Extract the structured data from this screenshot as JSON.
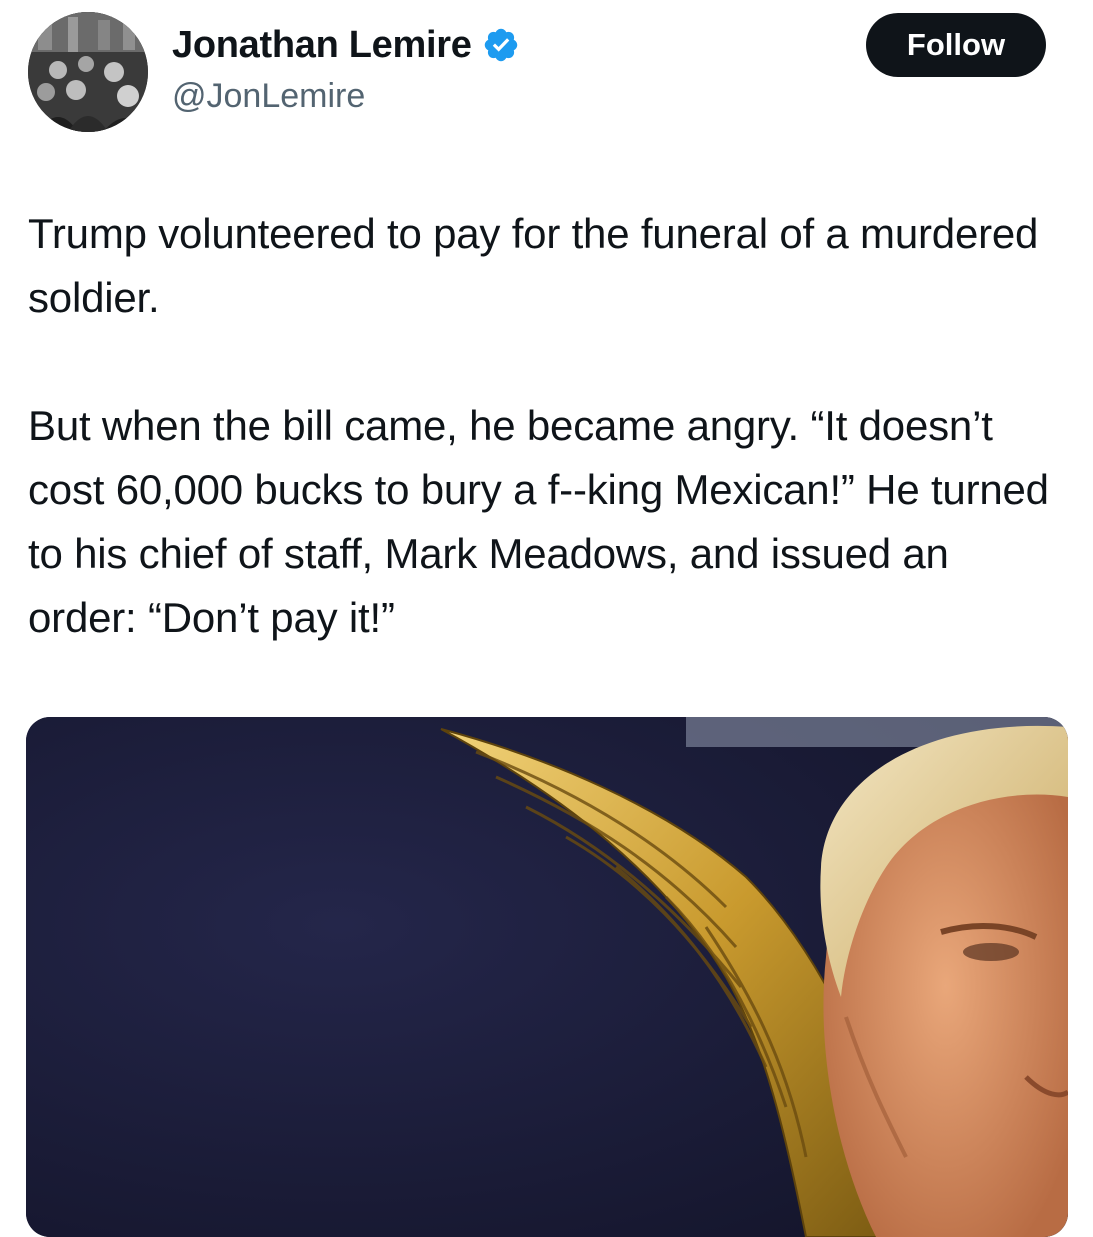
{
  "author": {
    "display_name": "Jonathan Lemire",
    "handle": "@JonLemire",
    "verified_icon": "verified-badge-icon",
    "verified_color": "#1d9bf0"
  },
  "follow_button": {
    "label": "Follow"
  },
  "tweet": {
    "paragraphs": [
      "Trump volunteered to pay for the funeral of a murdered soldier.",
      "But when the bill came, he became angry. “It doesn’t cost 60,000 bucks to bury a f--king Mexican!” He turned to his chief of staff, Mark Meadows, and issued an order: “Don’t pay it!”"
    ]
  },
  "media": {
    "type": "photo"
  }
}
